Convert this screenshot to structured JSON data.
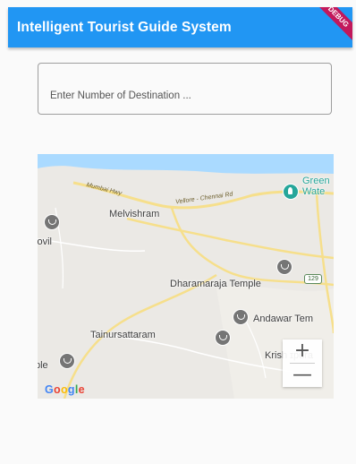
{
  "app": {
    "title": "Intelligent Tourist Guide System",
    "debug_banner": "DEBUG"
  },
  "destination_input": {
    "placeholder": "Enter Number of Destination ..."
  },
  "map": {
    "labels": {
      "melvishram": "Melvishram",
      "kovil": "kovil",
      "dharamaraja_temple": "Dharamaraja Temple",
      "andawar_temple": "Andawar Tem",
      "tainursattaram": "Tainursattaram",
      "krishnapuram": "Krish  ɪpura",
      "temple_left": "ple",
      "green_water_1": "Green",
      "green_water_2": "Wate",
      "road_mumbai": "Mumbai Hwy",
      "road_vellore": "Vellore - Chennai Rd",
      "highway_number": "129"
    },
    "zoom_in_label": "+",
    "zoom_out_label": "—",
    "attribution": {
      "g1": "G",
      "o1": "o",
      "o2": "o",
      "g2": "g",
      "l": "l",
      "e": "e"
    }
  },
  "colors": {
    "appbar": "#2196f3",
    "water": "#aadaff",
    "road_major": "#f6df8b",
    "road_minor": "#ffffff",
    "land": "#ebe9e5"
  }
}
